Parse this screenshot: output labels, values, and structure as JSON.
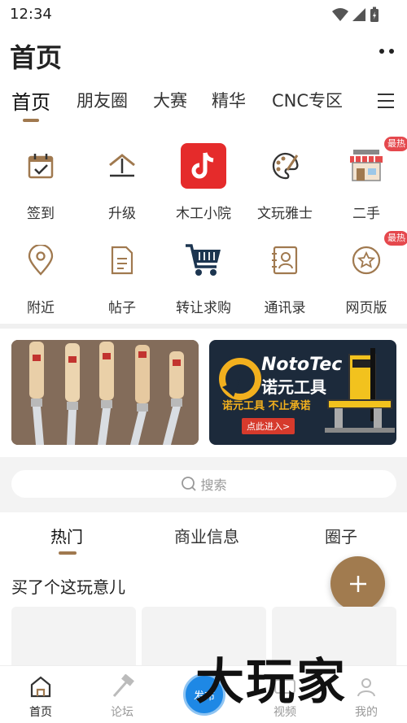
{
  "status": {
    "time": "12:34"
  },
  "header": {
    "title": "首页"
  },
  "top_tabs": [
    {
      "label": "首页"
    },
    {
      "label": "朋友圈"
    },
    {
      "label": "大赛"
    },
    {
      "label": "精华"
    },
    {
      "label": "CNC专区"
    }
  ],
  "grid": [
    {
      "label": "签到",
      "icon": "calendar-check-icon"
    },
    {
      "label": "升级",
      "icon": "upgrade-icon"
    },
    {
      "label": "木工小院",
      "icon": "tiktok-icon"
    },
    {
      "label": "文玩雅士",
      "icon": "palette-icon"
    },
    {
      "label": "二手",
      "icon": "shop-icon",
      "badge": "最热"
    },
    {
      "label": "附近",
      "icon": "location-pin-icon"
    },
    {
      "label": "帖子",
      "icon": "document-icon"
    },
    {
      "label": "转让求购",
      "icon": "cart-icon"
    },
    {
      "label": "通讯录",
      "icon": "contacts-icon"
    },
    {
      "label": "网页版",
      "icon": "star-circle-icon",
      "badge": "最热"
    }
  ],
  "banners": {
    "right": {
      "brand_en": "NotoTec",
      "brand_cn": "诺元工具",
      "slogan": "诺元工具 不止承诺",
      "cta": "点此进入>"
    }
  },
  "search": {
    "placeholder": "搜索"
  },
  "content_tabs": [
    {
      "label": "热门"
    },
    {
      "label": "商业信息"
    },
    {
      "label": "圈子"
    }
  ],
  "section": {
    "title": "买了个这玩意儿"
  },
  "bottom_nav": [
    {
      "label": "首页"
    },
    {
      "label": "论坛"
    },
    {
      "label": "发布"
    },
    {
      "label": "视频"
    },
    {
      "label": "我的"
    }
  ],
  "watermark": "大玩家",
  "colors": {
    "accent": "#a17b4f",
    "badge": "#e5484d",
    "publish": "#1e88e5"
  }
}
